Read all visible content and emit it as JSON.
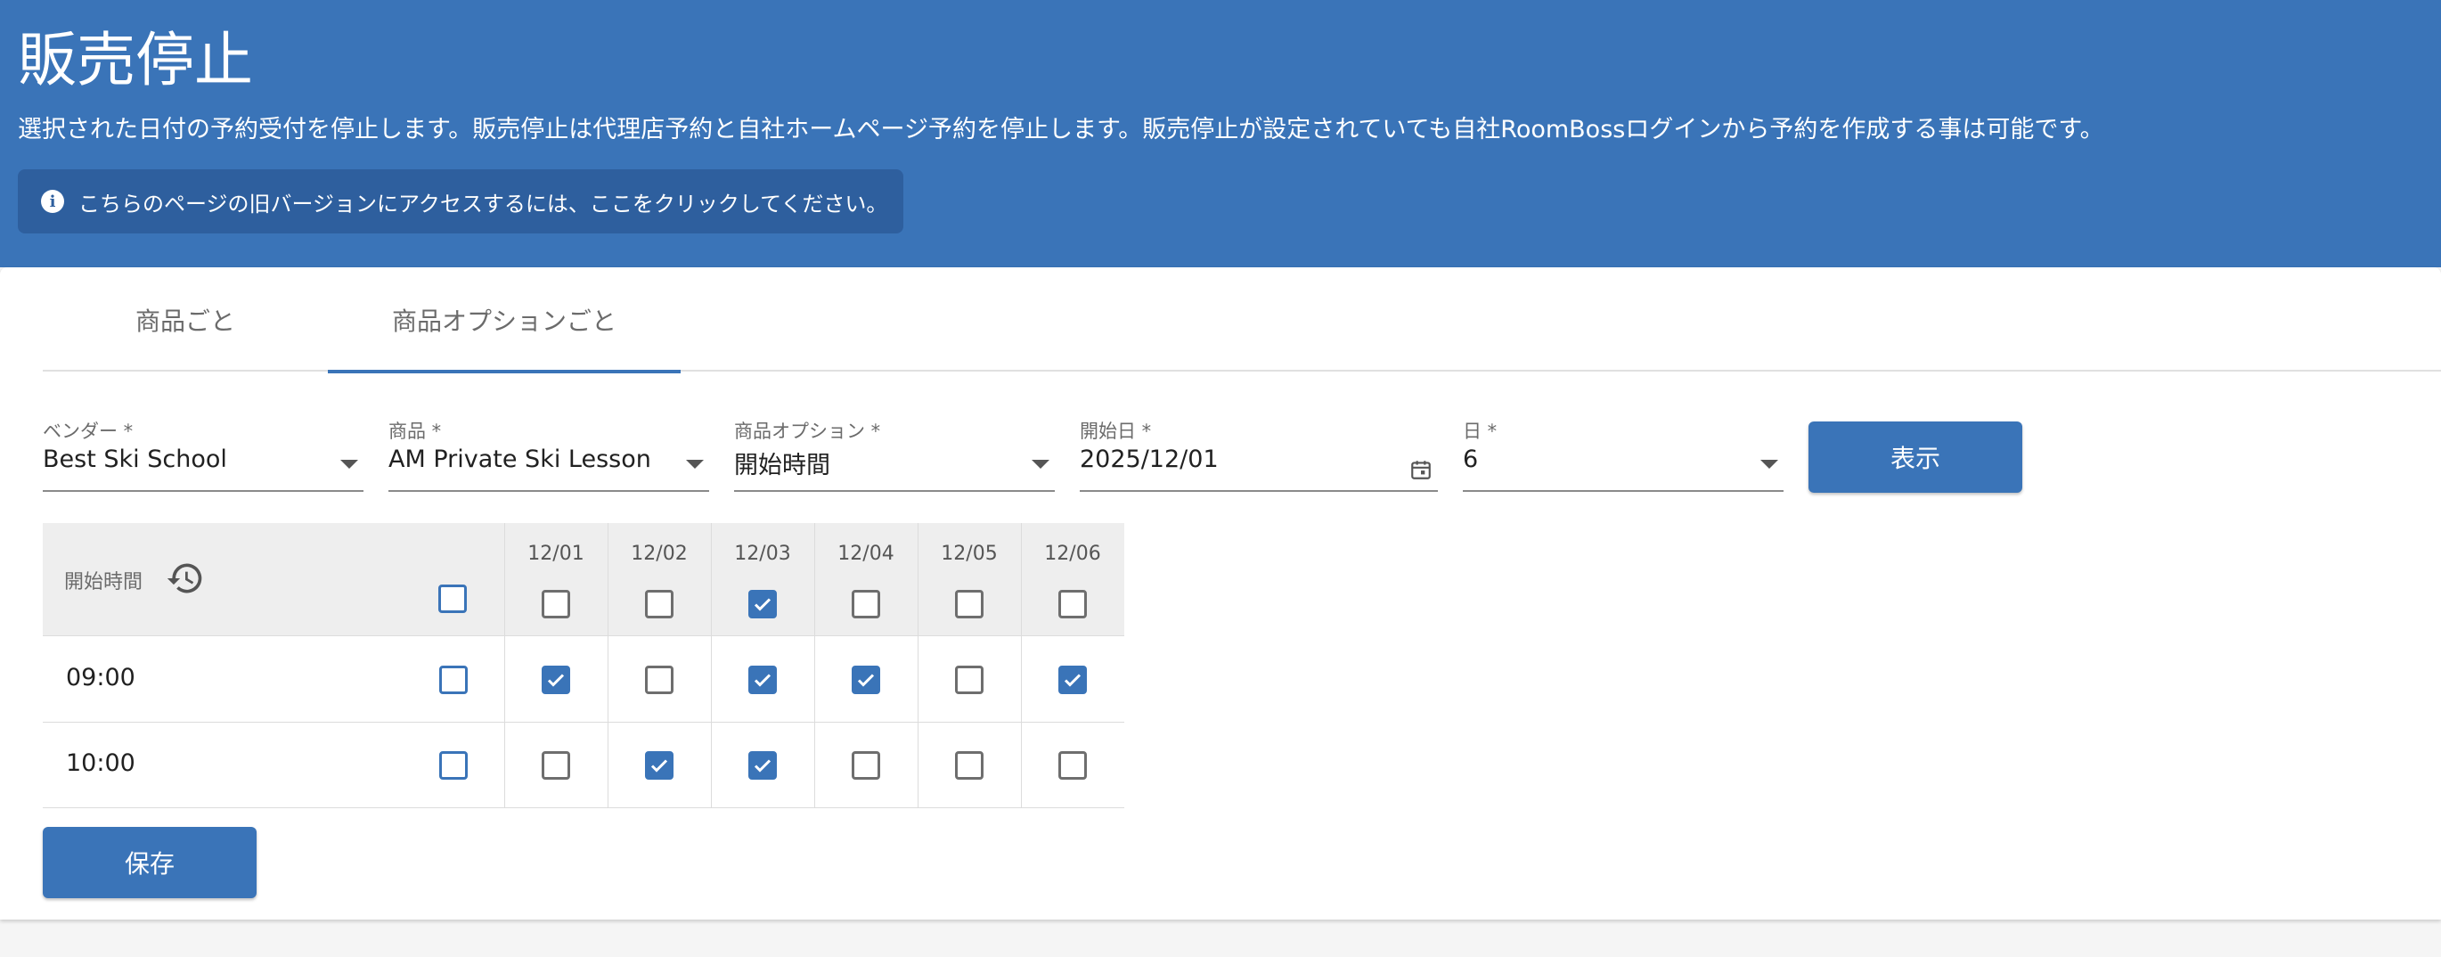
{
  "header": {
    "title": "販売停止",
    "description": "選択された日付の予約受付を停止します。販売停止は代理店予約と自社ホームページ予約を停止します。販売停止が設定されていても自社RoomBossログインから予約を作成する事は可能です。",
    "notice": "こちらのページの旧バージョンにアクセスするには、ここをクリックしてください。",
    "notice_icon": "info-icon",
    "background_color": "#3a74b8"
  },
  "tabs": [
    {
      "label": "商品ごと",
      "active": false
    },
    {
      "label": "商品オプションごと",
      "active": true
    }
  ],
  "filters": {
    "vendor": {
      "label": "ベンダー *",
      "value": "Best Ski School"
    },
    "product": {
      "label": "商品 *",
      "value": "AM Private Ski Lesson"
    },
    "option": {
      "label": "商品オプション *",
      "value": "開始時間"
    },
    "start_date": {
      "label": "開始日 *",
      "value": "2025/12/01"
    },
    "days": {
      "label": "日 *",
      "value": "6"
    },
    "show_label": "表示"
  },
  "grid": {
    "time_header": "開始時間",
    "dates": [
      "12/01",
      "12/02",
      "12/03",
      "12/04",
      "12/05",
      "12/06"
    ],
    "header_all_checked": false,
    "header_checks": [
      false,
      false,
      true,
      false,
      false,
      false
    ],
    "rows": [
      {
        "time": "09:00",
        "all": false,
        "checks": [
          true,
          false,
          true,
          true,
          false,
          true
        ]
      },
      {
        "time": "10:00",
        "all": false,
        "checks": [
          false,
          true,
          true,
          false,
          false,
          false
        ]
      }
    ]
  },
  "save_label": "保存"
}
